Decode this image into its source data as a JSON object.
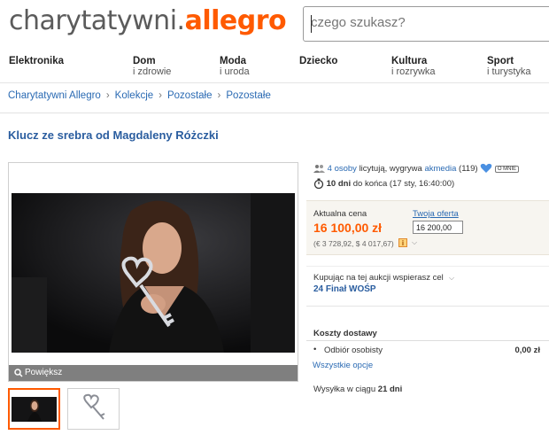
{
  "header": {
    "logo_part1": "charytatywni.",
    "logo_part2": "allegro",
    "search_placeholder": "czego szukasz?"
  },
  "nav": [
    {
      "title": "Elektronika",
      "sub": ""
    },
    {
      "title": "Dom",
      "sub": "i zdrowie"
    },
    {
      "title": "Moda",
      "sub": "i uroda"
    },
    {
      "title": "Dziecko",
      "sub": ""
    },
    {
      "title": "Kultura",
      "sub": "i rozrywka"
    },
    {
      "title": "Sport",
      "sub": "i turystyka"
    }
  ],
  "breadcrumb": [
    "Charytatywni Allegro",
    "Kolekcje",
    "Pozostałe",
    "Pozostałe"
  ],
  "breadcrumb_separator": "›",
  "auction": {
    "title": "Klucz ze srebra od Magdaleny Różczki",
    "bidders_link": "4 osoby",
    "bidders_text": "licytują, wygrywa",
    "winner": "akmedia",
    "winner_rating": "(119)",
    "badge": "O MNIE",
    "time_bold": "10 dni",
    "time_text": "do końca (17 sty, 16:40:00)",
    "current_price_label": "Aktualna cena",
    "current_price": "16 100,00 zł",
    "price_conversion": "(€ 3 728,92, $ 4 017,67)",
    "your_offer_label": "Twoja oferta",
    "your_offer_value": "16 200,00",
    "charity_text": "Kupując na tej aukcji wspierasz cel",
    "charity_name": "24 Finał WOŚP",
    "magnify_label": "Powiększ"
  },
  "shipping": {
    "title": "Koszty dostawy",
    "option": "Odbiór osobisty",
    "option_price": "0,00 zł",
    "all_options_link": "Wszystkie opcje",
    "delivery_prefix": "Wysyłka w ciągu",
    "delivery_days": "21 dni"
  },
  "colors": {
    "accent": "#ff5a00",
    "link": "#2a6ab3",
    "title": "#2a5d9f"
  }
}
